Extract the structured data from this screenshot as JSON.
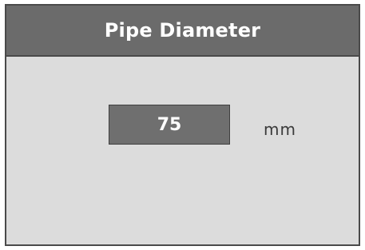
{
  "panel": {
    "title": "Pipe Diameter",
    "value": "75",
    "unit": "mm"
  },
  "colors": {
    "header_bg": "#6b6b6b",
    "panel_bg": "#dcdcdc",
    "value_box_bg": "#6f6f6f",
    "border": "#4a4a4a",
    "header_text": "#ffffff",
    "unit_text": "#3a3a3a"
  }
}
